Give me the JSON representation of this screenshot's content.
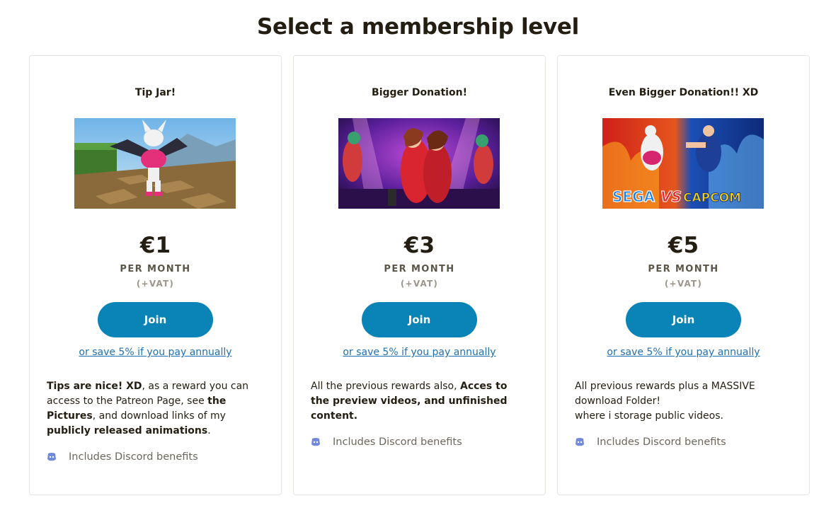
{
  "page": {
    "title": "Select a membership level"
  },
  "colors": {
    "accent": "#0a83b6",
    "link": "#1f6fb0",
    "discord": "#7289da",
    "text": "#241e12"
  },
  "tiers": [
    {
      "title": "Tip Jar!",
      "image_icon": "tier-image-tip-jar",
      "price": "€1",
      "period": "PER MONTH",
      "vat": "(+VAT)",
      "join_label": "Join",
      "annual_link": "or save 5% if you pay annually",
      "description": [
        {
          "text": "Tips are nice! XD",
          "bold": true
        },
        {
          "text": ", as a reward you can access to the Patreon Page, see ",
          "bold": false
        },
        {
          "text": "the Pictures",
          "bold": true
        },
        {
          "text": ", and download links of my ",
          "bold": false
        },
        {
          "text": "publicly released animations",
          "bold": true
        },
        {
          "text": ".",
          "bold": false
        }
      ],
      "benefit_icon": "discord-icon",
      "benefit_label": "Includes Discord benefits"
    },
    {
      "title": "Bigger Donation!",
      "image_icon": "tier-image-bigger-donation",
      "price": "€3",
      "period": "PER MONTH",
      "vat": "(+VAT)",
      "join_label": "Join",
      "annual_link": "or save 5% if you pay annually",
      "description": [
        {
          "text": "All the previous rewards also, ",
          "bold": false
        },
        {
          "text": "Acces to the preview videos, and unfinished content.",
          "bold": true
        }
      ],
      "benefit_icon": "discord-icon",
      "benefit_label": "Includes Discord benefits"
    },
    {
      "title": "Even Bigger Donation!! XD",
      "image_icon": "tier-image-sega-vs-capcom",
      "image_text": [
        "SEGA",
        "VS",
        "CAPCOM"
      ],
      "price": "€5",
      "period": "PER MONTH",
      "vat": "(+VAT)",
      "join_label": "Join",
      "annual_link": "or save 5% if you pay annually",
      "description": [
        {
          "text": "All previous rewards plus a MASSIVE download Folder!",
          "bold": false
        },
        {
          "text": "where i storage public videos.",
          "bold": false,
          "newline": true
        }
      ],
      "benefit_icon": "discord-icon",
      "benefit_label": "Includes Discord benefits"
    }
  ]
}
